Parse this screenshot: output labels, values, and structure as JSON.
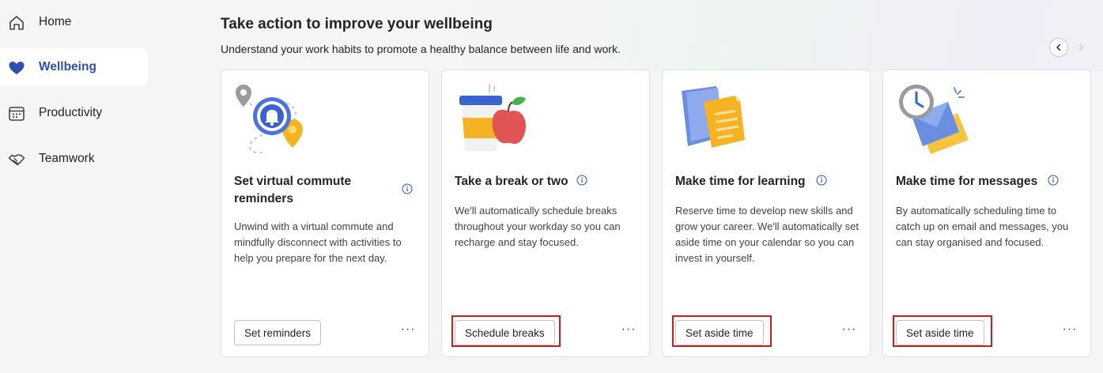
{
  "sidebar": {
    "items": [
      {
        "label": "Home",
        "icon": "home-icon"
      },
      {
        "label": "Wellbeing",
        "icon": "heart-icon"
      },
      {
        "label": "Productivity",
        "icon": "calendar-icon"
      },
      {
        "label": "Teamwork",
        "icon": "handshake-icon"
      }
    ],
    "active": "Wellbeing"
  },
  "main": {
    "title": "Take action to improve your wellbeing",
    "subtitle": "Understand your work habits to promote a healthy balance between life and work.",
    "cards": [
      {
        "title": "Set virtual commute reminders",
        "description": "Unwind with a virtual commute and mindfully disconnect with activities to help you prepare for the next day.",
        "button": "Set reminders",
        "more": "···",
        "illustration": "commute-reminder-icon"
      },
      {
        "title": "Take a break or two",
        "description": "We'll automatically schedule breaks throughout your workday so you can recharge and stay focused.",
        "button": "Schedule breaks",
        "more": "···",
        "illustration": "coffee-apple-icon"
      },
      {
        "title": "Make time for learning",
        "description": "Reserve time to develop new skills and grow your career. We'll automatically set aside time on your calendar so you can invest in yourself.",
        "button": "Set aside time",
        "more": "···",
        "illustration": "books-icon"
      },
      {
        "title": "Make time for messages",
        "description": "By automatically scheduling time to catch up on email and messages, you can stay organised and focused.",
        "button": "Set aside time",
        "more": "···",
        "illustration": "clock-mail-icon"
      }
    ]
  },
  "colors": {
    "accent": "#2f4fb0",
    "highlight": "#d11a1a",
    "card_bg": "#ffffff",
    "page_bg": "#f5f5f5"
  }
}
